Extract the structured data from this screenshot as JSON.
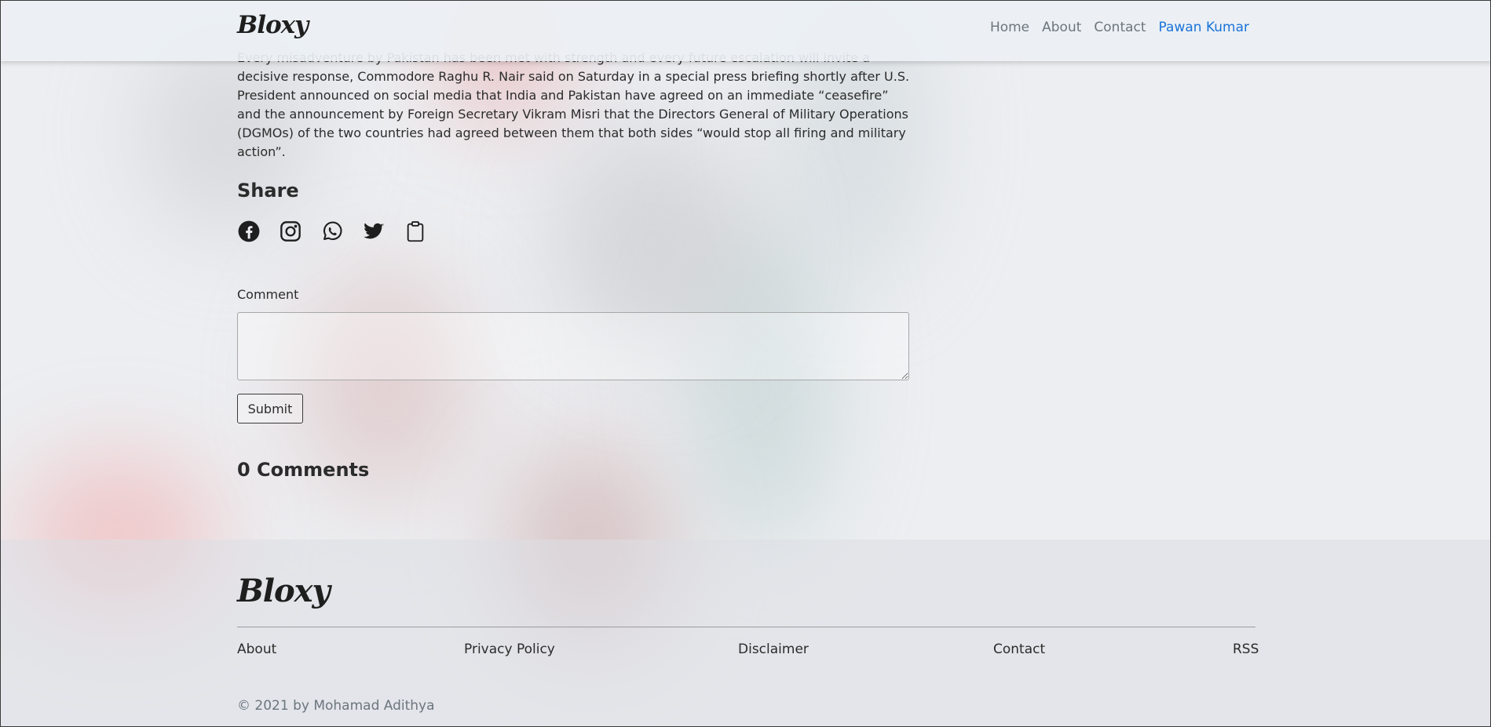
{
  "nav": {
    "brand": "Bloxy",
    "links": [
      "Home",
      "About",
      "Contact",
      "Pawan Kumar"
    ]
  },
  "article": {
    "text": "Every misadventure by Pakistan has been met with strength and every future escalation will invite a decisive response, Commodore Raghu R. Nair said on Saturday in a special press briefing shortly after U.S. President announced on social media that India and Pakistan have agreed on an immediate “ceasefire” and the announcement by Foreign Secretary Vikram Misri that the Directors General of Military Operations (DGMOs) of the two countries had agreed between them that both sides “would stop all firing and military action”."
  },
  "share": {
    "title": "Share",
    "icons": [
      "facebook-icon",
      "instagram-icon",
      "whatsapp-icon",
      "twitter-icon",
      "clipboard-icon"
    ]
  },
  "comment_form": {
    "label": "Comment",
    "value": "",
    "submit_label": "Submit"
  },
  "comments": {
    "count_label": "0 Comments"
  },
  "footer": {
    "brand": "Bloxy",
    "links": [
      "About",
      "Privacy Policy",
      "Disclaimer",
      "Contact",
      "RSS"
    ],
    "copyright": "© 2021 by Mohamad Adithya"
  },
  "colors": {
    "active_link": "#1a73d9",
    "muted_link": "#6c757d",
    "text": "#2b2b2b"
  }
}
